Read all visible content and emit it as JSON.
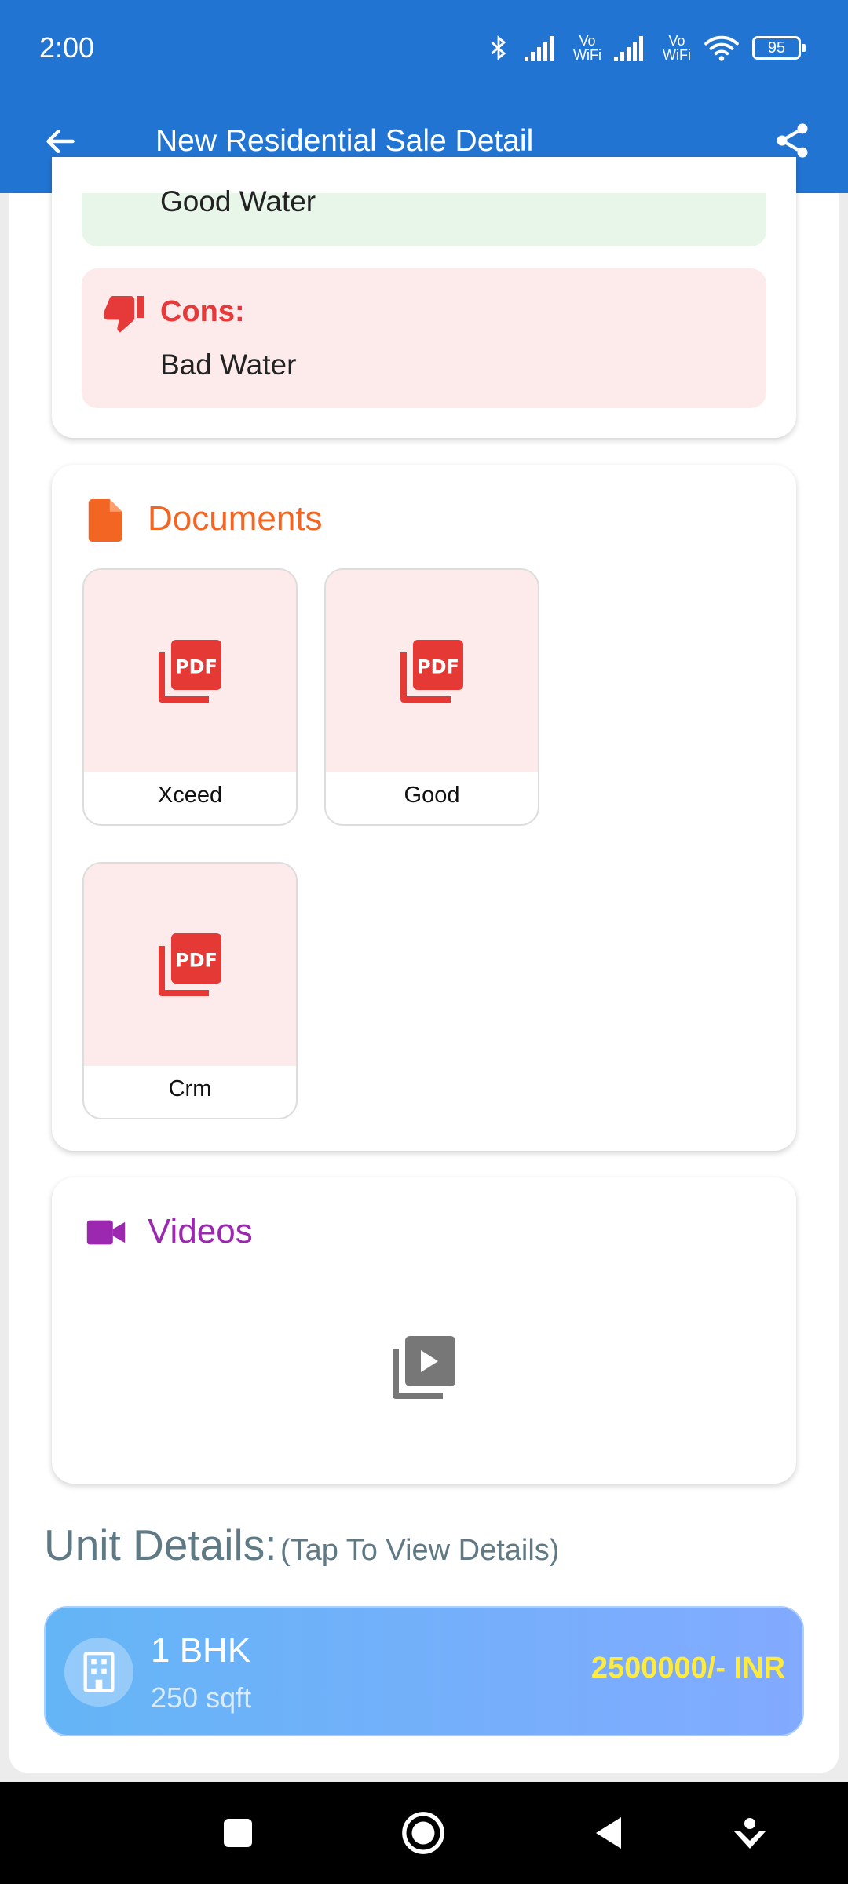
{
  "status_bar": {
    "time": "2:00",
    "vowifi_1": "Vo\nWiFi",
    "vowifi_2": "Vo\nWiFi",
    "battery": "95"
  },
  "app_bar": {
    "title": "New Residential Sale Detail"
  },
  "pros_cons": {
    "pros_text": "Good Water",
    "cons_label": "Cons:",
    "cons_text": "Bad Water"
  },
  "documents": {
    "title": "Documents",
    "items": [
      {
        "label": "Xceed"
      },
      {
        "label": "Good"
      },
      {
        "label": "Crm"
      }
    ]
  },
  "videos": {
    "title": "Videos"
  },
  "unit_details": {
    "heading": "Unit Details:",
    "hint": "(Tap To View Details)",
    "unit": {
      "title": "1 BHK",
      "area": "250 sqft",
      "price": "2500000/- INR"
    }
  },
  "colors": {
    "primary": "#2274d2",
    "documents_accent": "#f26522",
    "videos_accent": "#9c27b0",
    "cons_accent": "#e5393a",
    "pdf_red": "#e53935",
    "price_yellow": "#ffeb3b"
  }
}
